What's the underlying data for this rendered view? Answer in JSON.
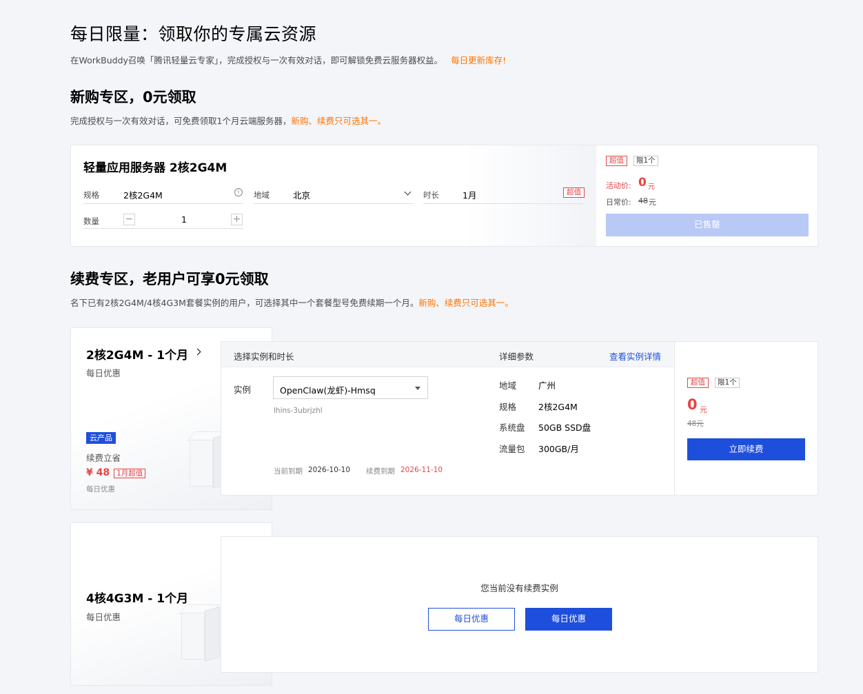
{
  "header": {
    "title": "每日限量：领取你的专属云资源",
    "desc": "在WorkBuddy召唤「腾讯轻量云专家」，完成授权与一次有效对话，即可解锁免费云服务器权益。",
    "desc_highlight": "每日更新库存!"
  },
  "new_section": {
    "title": "新购专区，0元领取",
    "desc": "完成授权与一次有效对话，可免费领取1个月云端服务器，",
    "desc_highlight": "新购、续费只可选其一。",
    "card": {
      "title": "轻量应用服务器 2核2G4M",
      "spec_label": "规格",
      "spec_value": "2核2G4M",
      "info_glyph": "i",
      "region_label": "地域",
      "region_value": "北京",
      "duration_label": "时长",
      "duration_value": "1月",
      "duration_tag": "超值",
      "qty_label": "数量",
      "qty_minus": "−",
      "qty_value": "1",
      "qty_plus": "+",
      "tag_value": "超值",
      "tag_limit": "限1个",
      "promo_label": "活动价:",
      "promo_price": "0",
      "promo_unit": "元",
      "regular_label": "日常价:",
      "regular_price": "48",
      "regular_unit": "元",
      "sold_out_label": "已售罄"
    }
  },
  "renew_section": {
    "title": "续费专区，老用户可享0元领取",
    "desc": "名下已有2核2G4M/4核4G3M套餐实例的用户，可选择其中一个套餐型号免费续期一个月。",
    "desc_highlight": "新购、续费只可选其一。",
    "pkg1": {
      "title": "2核2G4M - 1个月",
      "subtitle": "每日优惠",
      "badge": "云产品",
      "renew_save": "续费立省",
      "price": "¥ 48",
      "price_tag": "1月超值",
      "footnote": "每日优惠"
    },
    "panel": {
      "head_left": "选择实例和时长",
      "head_mid": "详细参数",
      "head_link": "查看实例详情",
      "instance_label": "实例",
      "instance_value": "OpenClaw(龙虾)-Hmsq",
      "instance_id": "lhins-3ubrjzhl",
      "current_expire_label": "当前到期",
      "current_expire": "2026-10-10",
      "renew_expire_label": "续费到期",
      "renew_expire": "2026-11-10",
      "params": [
        {
          "k": "地域",
          "v": "广州"
        },
        {
          "k": "规格",
          "v": "2核2G4M"
        },
        {
          "k": "系统盘",
          "v": "50GB SSD盘"
        },
        {
          "k": "流量包",
          "v": "300GB/月"
        }
      ]
    },
    "side": {
      "tag_value": "超值",
      "tag_limit": "限1个",
      "price": "0",
      "unit": "元",
      "orig_price": "48元",
      "renew_button": "立即续费"
    },
    "pkg2": {
      "title": "4核4G3M - 1个月",
      "subtitle": "每日优惠"
    },
    "empty": {
      "message": "您当前没有续费实例",
      "button_outline": "每日优惠",
      "button_primary": "每日优惠"
    }
  }
}
